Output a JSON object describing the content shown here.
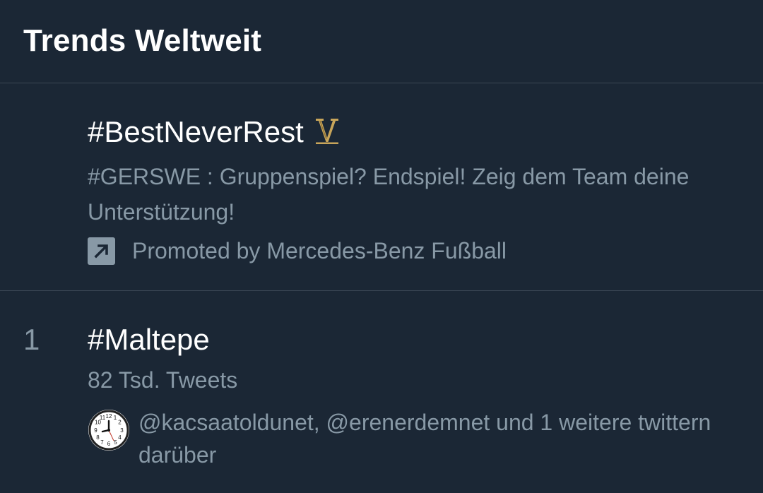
{
  "header": {
    "title": "Trends Weltweit"
  },
  "trends": [
    {
      "name": "#BestNeverRest",
      "emoji": "V-emoji",
      "description": "#GERSWE : Gruppenspiel? Endspiel! Zeig dem Team deine Unterstützung!",
      "promoted_label": "Promoted by Mercedes-Benz Fußball",
      "promoted_icon": "promoted-arrow-icon"
    },
    {
      "rank": "1",
      "name": "#Maltepe",
      "tweet_count": "82 Tsd. Tweets",
      "context": "@kacsaatoldunet, @erenerdemnet und 1 weitere twittern darüber",
      "context_icon": "clock-icon"
    }
  ],
  "colors": {
    "background": "#1b2735",
    "divider": "#3b4754",
    "secondary_text": "#8899a6",
    "primary_text": "#ffffff",
    "emoji_gold": "#c8a55a"
  }
}
